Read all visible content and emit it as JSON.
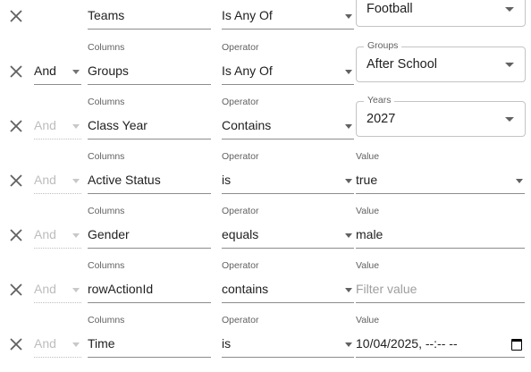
{
  "labels": {
    "columns": "Columns",
    "operator": "Operator",
    "value": "Value"
  },
  "rows": [
    {
      "logic": "",
      "column": "Teams",
      "operator": "Is Any Of",
      "value_legend": "",
      "value": "Football"
    },
    {
      "logic": "And",
      "column": "Groups",
      "operator": "Is Any Of",
      "value_legend": "Groups",
      "value": "After School"
    },
    {
      "logic": "And",
      "column": "Class Year",
      "operator": "Contains",
      "value_legend": "Years",
      "value": "2027"
    },
    {
      "logic": "And",
      "column": "Active Status",
      "operator": "is",
      "value": "true"
    },
    {
      "logic": "And",
      "column": "Gender",
      "operator": "equals",
      "value": "male"
    },
    {
      "logic": "And",
      "column": "rowActionId",
      "operator": "contains",
      "value": "",
      "placeholder": "Filter value"
    },
    {
      "logic": "And",
      "column": "Time",
      "operator": "is",
      "value": "10/04/2025, --:-- --"
    }
  ]
}
